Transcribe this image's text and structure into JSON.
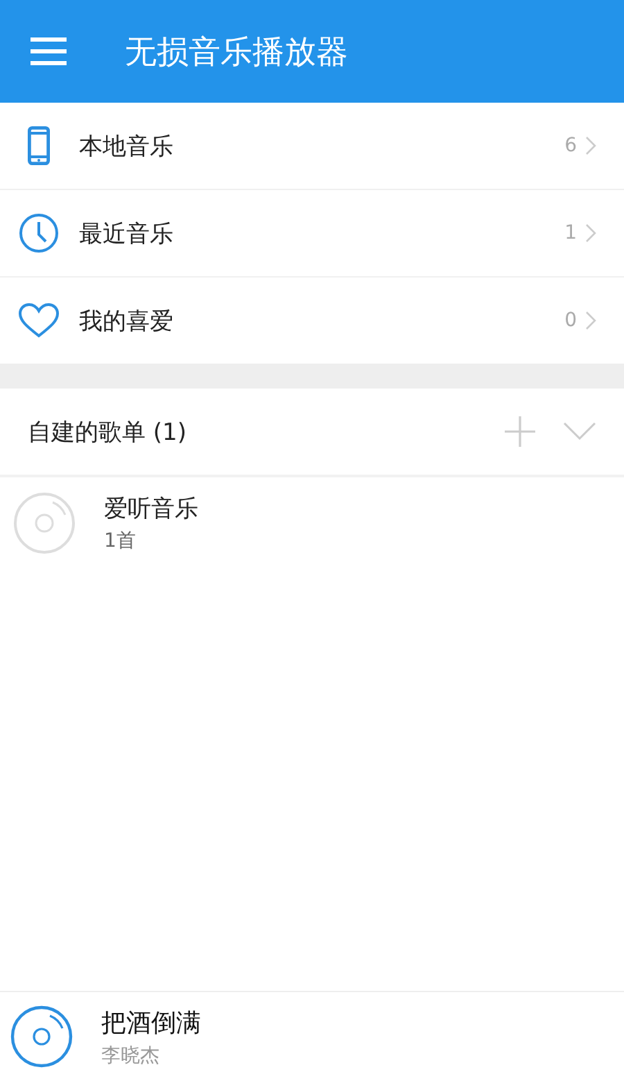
{
  "app_bar": {
    "title": "无损音乐播放器"
  },
  "library": [
    {
      "kind": "phone",
      "label": "本地音乐",
      "count": "6"
    },
    {
      "kind": "clock",
      "label": "最近音乐",
      "count": "1"
    },
    {
      "kind": "heart",
      "label": "我的喜爱",
      "count": "0"
    }
  ],
  "playlists_section": {
    "title": "自建的歌单 (1)",
    "expanded": true,
    "items": [
      {
        "name": "爱听音乐",
        "count": "1首"
      }
    ]
  },
  "now_playing": {
    "title": "把酒倒满",
    "artist": "李晓杰"
  }
}
